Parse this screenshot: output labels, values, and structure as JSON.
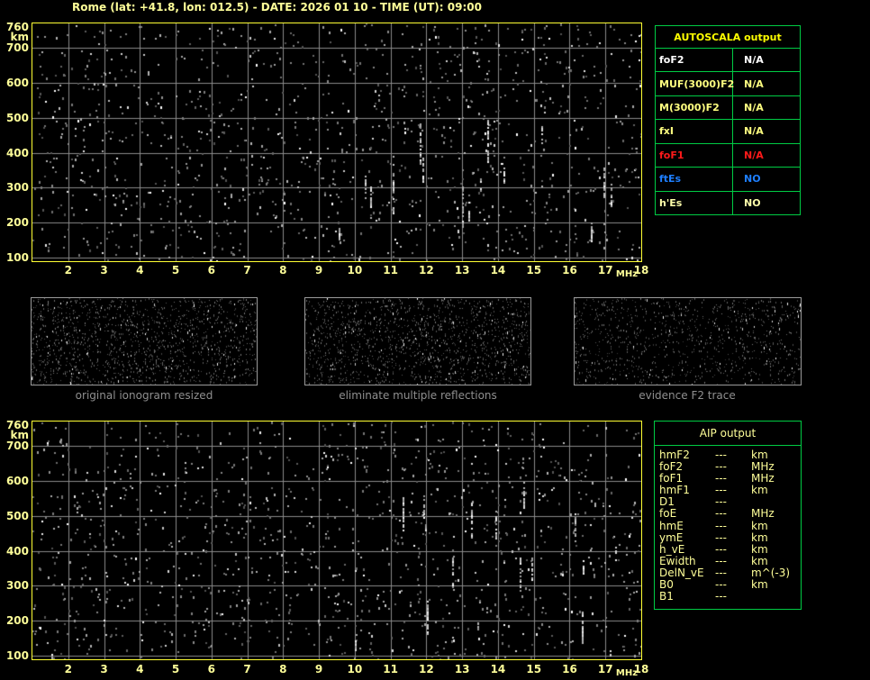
{
  "title": "Rome (lat: +41.8, lon: 012.5) - DATE: 2026 01 10 - TIME (UT): 09:00",
  "colors": {
    "background": "#000000",
    "title_text": "#ffff99",
    "axis_text": "#ffff99",
    "plot_border": "#ffff33",
    "gridline": "#8a8a8a",
    "table_border": "#00cc44",
    "autoscala_header": "#ffff00",
    "caption_text": "#8f8f8f",
    "aip_text": "#ffff99"
  },
  "ionogram_axes": {
    "y_unit": "km",
    "y_ticks": [
      "760",
      "700",
      "600",
      "500",
      "400",
      "300",
      "200",
      "100"
    ],
    "x_ticks": [
      "2",
      "3",
      "4",
      "5",
      "6",
      "7",
      "8",
      "9",
      "10",
      "11",
      "12",
      "13",
      "14",
      "15",
      "16",
      "17",
      "18"
    ],
    "x_unit": "MHz"
  },
  "autoscala_table": {
    "header": "AUTOSCALA output",
    "rows": [
      {
        "label": "foF2",
        "value": "N/A",
        "color": "#ffffff"
      },
      {
        "label": "MUF(3000)F2",
        "value": "N/A",
        "color": "#ffff80"
      },
      {
        "label": "M(3000)F2",
        "value": "N/A",
        "color": "#ffff80"
      },
      {
        "label": "fxI",
        "value": "N/A",
        "color": "#ffff80"
      },
      {
        "label": "foF1",
        "value": "N/A",
        "color": "#ff1a1a"
      },
      {
        "label": "ftEs",
        "value": "NO",
        "color": "#1e7fff"
      },
      {
        "label": "h'Es",
        "value": "NO",
        "color": "#ffffaa"
      }
    ]
  },
  "thumbnails": [
    {
      "caption": "original ionogram resized"
    },
    {
      "caption": "eliminate multiple reflections"
    },
    {
      "caption": "evidence F2 trace"
    }
  ],
  "aip_table": {
    "header": "AIP output",
    "rows": [
      {
        "param": "hmF2",
        "value": "---",
        "unit": "km"
      },
      {
        "param": "foF2",
        "value": "---",
        "unit": "MHz"
      },
      {
        "param": "foF1",
        "value": "---",
        "unit": "MHz"
      },
      {
        "param": "hmF1",
        "value": "---",
        "unit": "km"
      },
      {
        "param": "D1",
        "value": "---",
        "unit": ""
      },
      {
        "param": "foE",
        "value": "---",
        "unit": "MHz"
      },
      {
        "param": "hmE",
        "value": "---",
        "unit": "km"
      },
      {
        "param": "ymE",
        "value": "---",
        "unit": "km"
      },
      {
        "param": "h_vE",
        "value": "---",
        "unit": "km"
      },
      {
        "param": "Ewidth",
        "value": "---",
        "unit": "km"
      },
      {
        "param": "DelN_vE",
        "value": "---",
        "unit": "m^(-3)"
      },
      {
        "param": "B0",
        "value": "---",
        "unit": "km"
      },
      {
        "param": "B1",
        "value": "---",
        "unit": ""
      }
    ]
  },
  "chart_data": [
    {
      "type": "scatter",
      "title": "ionogram panel (top, raw with AUTOSCALA grid)",
      "xlabel": "MHz",
      "ylabel": "km",
      "xlim": [
        1,
        18
      ],
      "ylim": [
        90,
        770
      ],
      "x_ticks": [
        2,
        3,
        4,
        5,
        6,
        7,
        8,
        9,
        10,
        11,
        12,
        13,
        14,
        15,
        16,
        17,
        18
      ],
      "y_ticks": [
        760,
        700,
        600,
        500,
        400,
        300,
        200,
        100
      ],
      "grid": true,
      "series": [
        {
          "name": "background noise",
          "description": "random speckle noise over full panel, no identifiable echo trace; brighter vertical interference streaks near 13.5-17 MHz below ~300 km"
        }
      ]
    },
    {
      "type": "scatter",
      "title": "ionogram panel (bottom, restored with AIP grid)",
      "xlabel": "MHz",
      "ylabel": "km",
      "xlim": [
        1,
        18
      ],
      "ylim": [
        90,
        770
      ],
      "x_ticks": [
        2,
        3,
        4,
        5,
        6,
        7,
        8,
        9,
        10,
        11,
        12,
        13,
        14,
        15,
        16,
        17,
        18
      ],
      "y_ticks": [
        760,
        700,
        600,
        500,
        400,
        300,
        200,
        100
      ],
      "grid": true,
      "series": [
        {
          "name": "background noise",
          "description": "same noise-only ionogram, no scaled trace; vertical interference streaks near 13-17 MHz at low virtual heights"
        }
      ]
    }
  ]
}
